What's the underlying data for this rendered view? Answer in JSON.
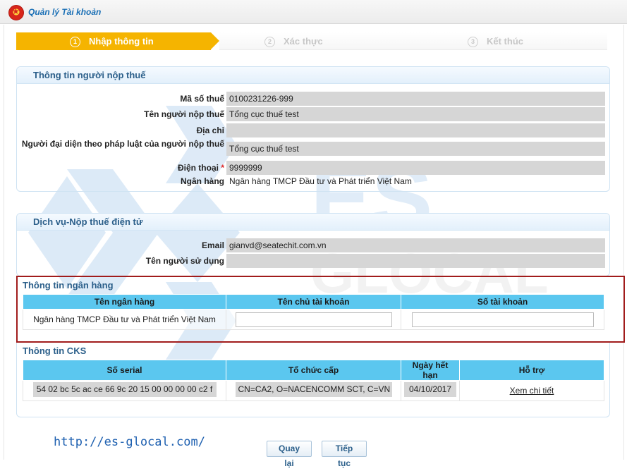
{
  "app": {
    "title": "Quản lý Tài khoản"
  },
  "steps": [
    {
      "num": "1",
      "label": "Nhập thông tin",
      "active": true
    },
    {
      "num": "2",
      "label": "Xác thực",
      "active": false
    },
    {
      "num": "3",
      "label": "Kết thúc",
      "active": false
    }
  ],
  "taxpayer": {
    "header": "Thông tin người nộp thuế",
    "fields": [
      {
        "label": "Mã số thuế",
        "value": "0100231226-999"
      },
      {
        "label": "Tên người nộp thuế",
        "value": "Tổng cục thuế test"
      },
      {
        "label": "Địa chỉ",
        "value": ""
      },
      {
        "label": "Người đại diện theo pháp luật của người nộp thuế",
        "value": "Tổng cục thuế test"
      },
      {
        "label": "Điện thoại",
        "required": "*",
        "value": "9999999"
      },
      {
        "label": "Ngân hàng",
        "value": "Ngân hàng TMCP Đầu tư và Phát triển Việt Nam"
      }
    ]
  },
  "service": {
    "header": "Dịch vụ-Nộp thuế điện tử",
    "fields": [
      {
        "label": "Email",
        "value": "gianvd@seatechit.com.vn"
      },
      {
        "label": "Tên người sử dụng",
        "value": ""
      }
    ]
  },
  "bank": {
    "title": "Thông tin ngân hàng",
    "columns": [
      "Tên ngân hàng",
      "Tên chủ tài khoản",
      "Số tài khoản"
    ],
    "row": {
      "bank_name": "Ngân hàng TMCP Đầu tư và Phát triển Việt Nam",
      "owner": "",
      "account": ""
    }
  },
  "cks": {
    "title": "Thông tin CKS",
    "columns": [
      "Số serial",
      "Tổ chức cấp",
      "Ngày hết hạn",
      "Hỗ trợ"
    ],
    "row": {
      "serial": "54 02 bc 5c ac ce 66 9c 20 15 00 00 00 00 c2 f",
      "issuer": "CN=CA2, O=NACENCOMM SCT, C=VN",
      "expiry": "04/10/2017",
      "support": "Xem chi tiết"
    }
  },
  "footer": {
    "url": "http://es-glocal.com/",
    "back_label": "Quay lại",
    "next_label": "Tiếp tục"
  },
  "watermark": {
    "text_top": "ES",
    "text_bottom": "GLOCAL",
    "color": "#2f7fd0"
  },
  "colors": {
    "step_active": "#f5b400",
    "table_header": "#5bc7ef",
    "highlight_border": "#a11c1c",
    "section_title": "#2b5f8a"
  }
}
